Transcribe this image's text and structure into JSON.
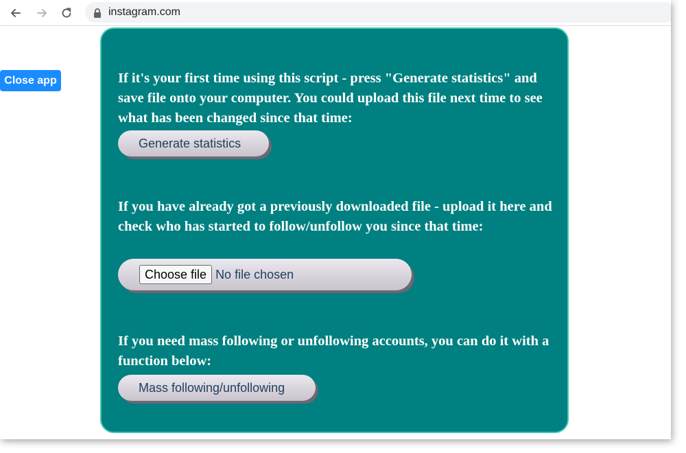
{
  "browser": {
    "url": "instagram.com",
    "icons": [
      "back-arrow-icon",
      "forward-arrow-icon",
      "reload-icon",
      "lock-icon"
    ]
  },
  "app": {
    "close_label": "Close app",
    "sections": [
      {
        "text": "If it's your first time using this script - press \"Generate statistics\" and save file onto your computer. You could upload this file next time to see what has been changed since that time:",
        "button_label": "Generate statistics"
      },
      {
        "text": "If you have already got a previously downloaded file - upload it here and check who has started to follow/unfollow you since that time:",
        "file_button_label": "Choose file",
        "file_status": "No file chosen"
      },
      {
        "text": "If you need mass following or unfollowing accounts, you can do it with a function below:",
        "button_label": "Mass following/unfollowing"
      }
    ]
  },
  "colors": {
    "panel_background": "#008080",
    "panel_border": "#3ec7b4",
    "close_button": "#1a8cff",
    "button_text": "#1d3f5e"
  }
}
